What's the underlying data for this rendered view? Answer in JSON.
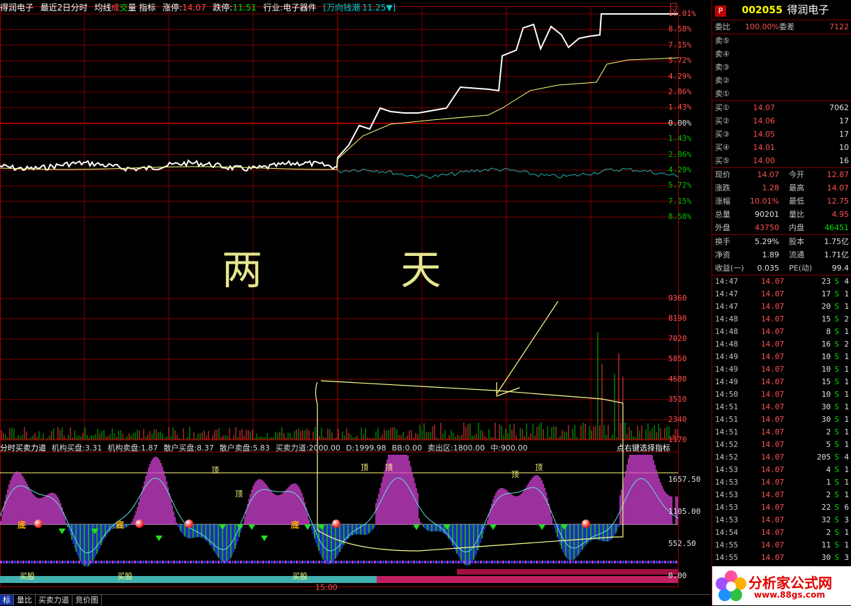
{
  "header": {
    "name": "得润电子",
    "title": "最近2日分时",
    "avg": "均线",
    "vol1": "成",
    "vol2": "交",
    "vol3": "量",
    "indicator": "指标",
    "limit_up_label": "涨停:",
    "limit_up": "14.07",
    "limit_down_label": "跌停:",
    "limit_down": "11.51",
    "industry_label": "行业:",
    "industry": "电子器件",
    "sector": "[万向钱潮",
    "sector_price": "11.25▼]",
    "corner": "□"
  },
  "price_axis_right": [
    "10.01%",
    "8.58%",
    "7.15%",
    "5.72%",
    "4.29%",
    "2.86%",
    "1.43%",
    "0.00%",
    "1.43%",
    "2.86%",
    "4.29%",
    "5.72%",
    "7.15%",
    "8.58%"
  ],
  "volume_axis": [
    "9360",
    "8190",
    "7020",
    "5850",
    "4680",
    "3510",
    "2340",
    "1170"
  ],
  "indicator_axis": [
    "1657.50",
    "1105.00",
    "552.50",
    "0.00"
  ],
  "handwriting": "两 天",
  "indicator_bar": {
    "name": "分时买卖力道",
    "items": [
      "机构买盘:3.31",
      "机构卖盘:1.87",
      "散户买盘:8.37",
      "散户卖盘:5.83",
      "买卖力道:2000.00",
      "D:1999.98",
      "BB:0.00",
      "卖出区:1800.00",
      "中:900.00"
    ],
    "hint": "点右键选择指标"
  },
  "chart_labels": {
    "top": "顶",
    "bottom": "底",
    "buy": "买股",
    "time": "15:00"
  },
  "tabs": [
    "标",
    "量比",
    "买卖力道",
    "竞价图"
  ],
  "sidebar": {
    "badge": "P",
    "code": "002055",
    "name": "得润电子",
    "wei": {
      "k1": "委比",
      "v1": "100.00%",
      "k2": "委差",
      "v2": "7122"
    },
    "sells": [
      {
        "k": "卖⑤"
      },
      {
        "k": "卖④"
      },
      {
        "k": "卖③"
      },
      {
        "k": "卖②"
      },
      {
        "k": "卖①"
      }
    ],
    "buys": [
      {
        "k": "买①",
        "p": "14.07",
        "v": "7062"
      },
      {
        "k": "买②",
        "p": "14.06",
        "v": "17"
      },
      {
        "k": "买③",
        "p": "14.05",
        "v": "17"
      },
      {
        "k": "买④",
        "p": "14.01",
        "v": "10"
      },
      {
        "k": "买⑤",
        "p": "14.00",
        "v": "16"
      }
    ],
    "stats1": [
      {
        "k1": "现价",
        "v1": "14.07",
        "k2": "今开",
        "v2": "12.87"
      },
      {
        "k1": "涨跌",
        "v1": "1.28",
        "k2": "最高",
        "v2": "14.07"
      },
      {
        "k1": "涨幅",
        "v1": "10.01%",
        "k2": "最低",
        "v2": "12.75"
      },
      {
        "k1": "总量",
        "v1": "90201",
        "k2": "量比",
        "v2": "4.95"
      },
      {
        "k1": "外盘",
        "v1": "43750",
        "k2": "内盘",
        "v2": "46451"
      }
    ],
    "stats2": [
      {
        "k1": "换手",
        "v1": "5.29%",
        "k2": "股本",
        "v2": "1.75亿"
      },
      {
        "k1": "净资",
        "v1": "1.89",
        "k2": "流通",
        "v2": "1.71亿"
      },
      {
        "k1": "收益(一)",
        "v1": "0.035",
        "k2": "PE(动)",
        "v2": "99.4"
      }
    ],
    "trades": [
      [
        "14:47",
        "14.07",
        "23",
        "S",
        "4"
      ],
      [
        "14:47",
        "14.07",
        "17",
        "S",
        "1"
      ],
      [
        "14:47",
        "14.07",
        "20",
        "S",
        "1"
      ],
      [
        "14:48",
        "14.07",
        "15",
        "S",
        "2"
      ],
      [
        "14:48",
        "14.07",
        "8",
        "S",
        "1"
      ],
      [
        "14:48",
        "14.07",
        "16",
        "S",
        "2"
      ],
      [
        "14:49",
        "14.07",
        "10",
        "S",
        "1"
      ],
      [
        "14:49",
        "14.07",
        "10",
        "S",
        "1"
      ],
      [
        "14:49",
        "14.07",
        "15",
        "S",
        "1"
      ],
      [
        "14:50",
        "14.07",
        "10",
        "S",
        "1"
      ],
      [
        "14:51",
        "14.07",
        "30",
        "S",
        "1"
      ],
      [
        "14:51",
        "14.07",
        "30",
        "S",
        "1"
      ],
      [
        "14:51",
        "14.07",
        "2",
        "S",
        "1"
      ],
      [
        "14:52",
        "14.07",
        "5",
        "S",
        "1"
      ],
      [
        "14:52",
        "14.07",
        "205",
        "S",
        "4"
      ],
      [
        "14:53",
        "14.07",
        "4",
        "S",
        "1"
      ],
      [
        "14:53",
        "14.07",
        "1",
        "S",
        "1"
      ],
      [
        "14:53",
        "14.07",
        "2",
        "S",
        "1"
      ],
      [
        "14:53",
        "14.07",
        "22",
        "S",
        "6"
      ],
      [
        "14:53",
        "14.07",
        "32",
        "S",
        "3"
      ],
      [
        "14:54",
        "14.07",
        "2",
        "S",
        "1"
      ],
      [
        "14:55",
        "14.07",
        "11",
        "S",
        "1"
      ],
      [
        "14:55",
        "14.07",
        "30",
        "S",
        "3"
      ]
    ],
    "logo_text": "分析家公式网",
    "logo_url": "www.88gs.com"
  }
}
